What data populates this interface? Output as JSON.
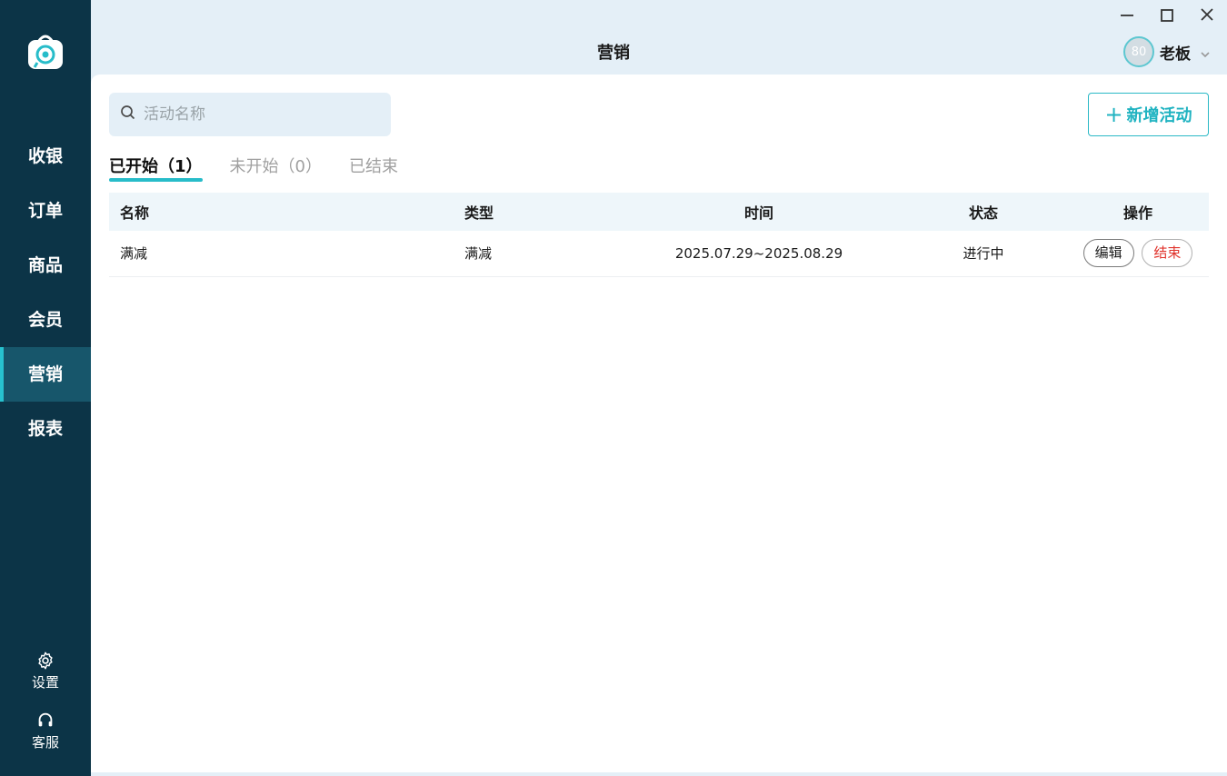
{
  "sidebar": {
    "items": [
      {
        "label": "收银",
        "active": false
      },
      {
        "label": "订单",
        "active": false
      },
      {
        "label": "商品",
        "active": false
      },
      {
        "label": "会员",
        "active": false
      },
      {
        "label": "营销",
        "active": true
      },
      {
        "label": "报表",
        "active": false
      }
    ],
    "settings_label": "设置",
    "service_label": "客服"
  },
  "header": {
    "title": "营销",
    "user": {
      "avatar_text": "80",
      "name": "老板"
    }
  },
  "main": {
    "search_placeholder": "活动名称",
    "add_button_label": "新增活动",
    "tabs": [
      {
        "label": "已开始（1）",
        "active": true
      },
      {
        "label": "未开始（0）",
        "active": false
      },
      {
        "label": "已结束",
        "active": false
      }
    ],
    "table": {
      "columns": [
        "名称",
        "类型",
        "时间",
        "状态",
        "操作"
      ],
      "rows": [
        {
          "name": "满减",
          "type": "满减",
          "time": "2025.07.29~2025.08.29",
          "status": "进行中",
          "actions": {
            "edit": "编辑",
            "end": "结束"
          }
        }
      ]
    }
  },
  "colors": {
    "sidebar_bg": "#0c3447",
    "sidebar_active": "#17566b",
    "accent": "#27bcc9",
    "danger": "#e0332c"
  }
}
